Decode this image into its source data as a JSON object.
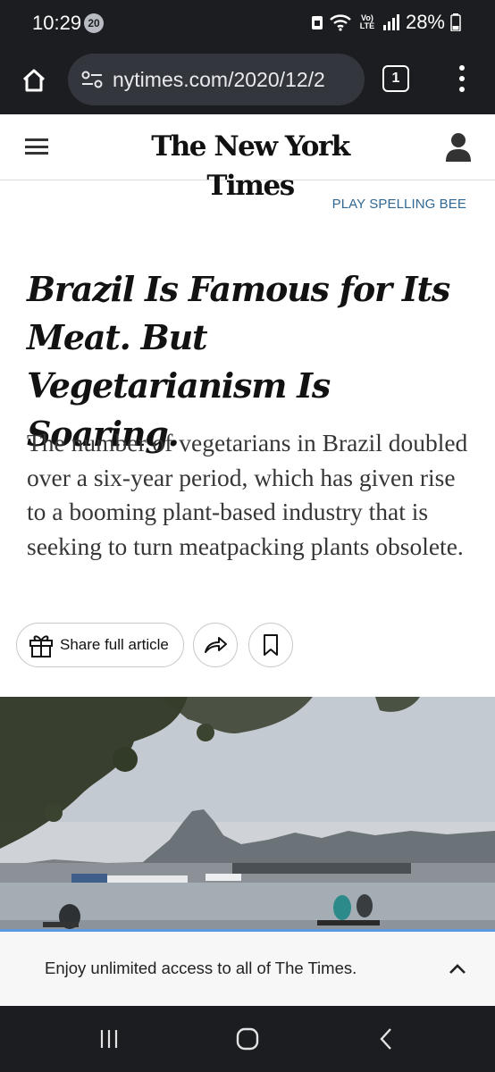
{
  "status_bar": {
    "time": "10:29",
    "notification_count": "20",
    "battery": "28%",
    "network_label": "Vo) LTE"
  },
  "browser": {
    "url": "nytimes.com/2020/12/2",
    "tab_count": "1"
  },
  "header": {
    "masthead": "The New York Times"
  },
  "promo": {
    "spelling_bee": "PLAY SPELLING BEE"
  },
  "article": {
    "headline": "Brazil Is Famous for Its Meat. But Vegetarianism Is Soaring.",
    "summary": "The number of vegetarians in Brazil doubled over a six-year period, which has given rise to a booming plant-based industry that is seeking to turn meatpacking plants obsolete."
  },
  "actions": {
    "share_full_article": "Share full article"
  },
  "banner": {
    "text": "Enjoy unlimited access to all of The Times."
  },
  "colors": {
    "system_bar": "#1c1d21",
    "link_blue": "#326891",
    "banner_accent": "#5c9adf"
  }
}
